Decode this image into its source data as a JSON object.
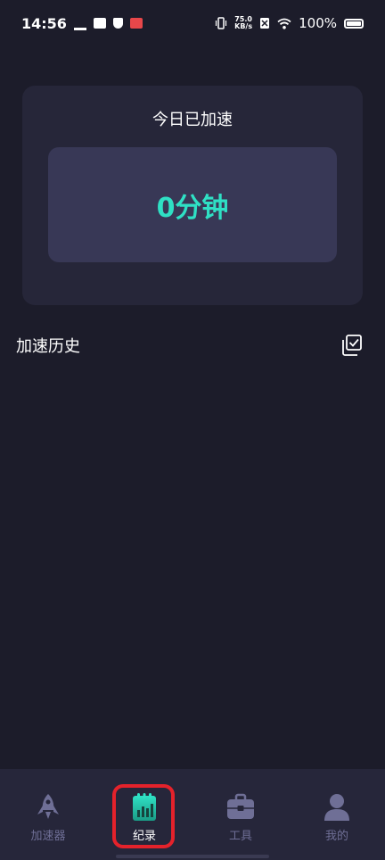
{
  "status_bar": {
    "time": "14:56",
    "net_speed_value": "75.0",
    "net_speed_unit": "KB/s",
    "battery": "100%"
  },
  "today_card": {
    "title": "今日已加速",
    "value": "0分钟"
  },
  "history": {
    "title": "加速历史"
  },
  "bottom_nav": {
    "items": [
      {
        "label": "加速器",
        "icon": "rocket-icon"
      },
      {
        "label": "纪录",
        "icon": "record-chart-icon",
        "active": true
      },
      {
        "label": "工具",
        "icon": "toolbox-icon"
      },
      {
        "label": "我的",
        "icon": "person-icon"
      }
    ]
  },
  "colors": {
    "background": "#1c1c2a",
    "card": "#262639",
    "card_inner": "#383856",
    "accent": "#2fe0c4",
    "nav_inactive": "#6f6f96",
    "highlight": "#e4222b"
  }
}
